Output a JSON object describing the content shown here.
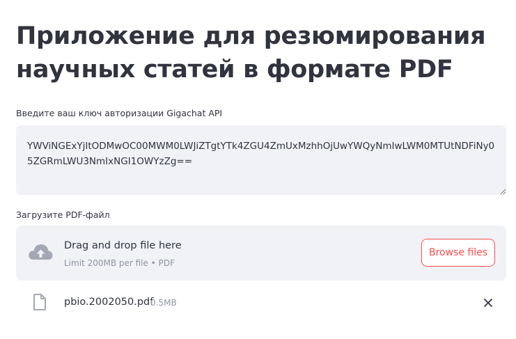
{
  "page": {
    "title": "Приложение для резюмирования научных статей в формате PDF"
  },
  "api_key": {
    "label": "Введите ваш ключ авторизации Gigachat API",
    "value": "YWViNGExYjItODMwOC00MWM0LWJiZTgtYTk4ZGU4ZmUxMzhhOjUwYWQyNmIwLWM0MTUtNDFiNy05ZGRmLWU3NmIxNGI1OWYzZg=="
  },
  "uploader": {
    "label": "Загрузите PDF-файл",
    "drop_text": "Drag and drop file here",
    "limit_text": "Limit 200MB per file • PDF",
    "browse_label": "Browse files",
    "accent_color": "#ff4b4b"
  },
  "uploaded_file": {
    "name": "pbio.2002050.pdf",
    "size": "0.5MB",
    "icon": "file-icon"
  }
}
